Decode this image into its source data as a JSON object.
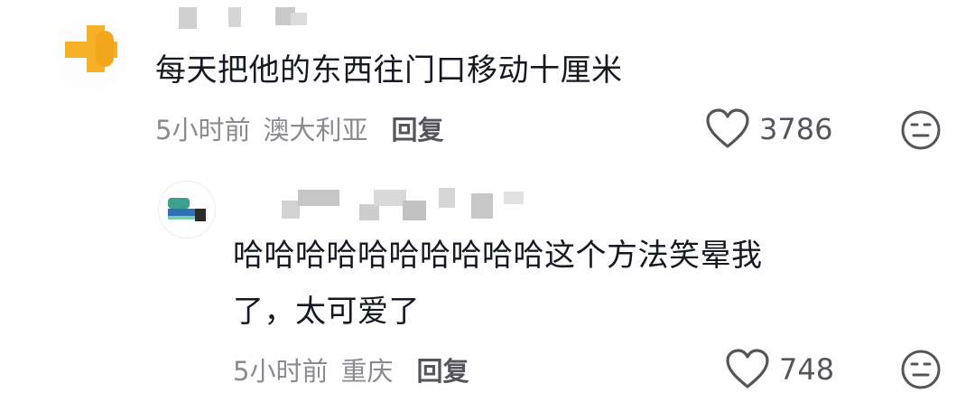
{
  "comments": [
    {
      "text": "每天把他的东西往门口移动十厘米",
      "time": "5小时前",
      "location": "澳大利亚",
      "reply_label": "回复",
      "likes": "3786"
    },
    {
      "text_line1": "哈哈哈哈哈哈哈哈哈哈这个方法笑晕我",
      "text_line2": "了，太可爱了",
      "time": "5小时前",
      "location": "重庆",
      "reply_label": "回复",
      "likes": "748"
    }
  ],
  "icons": {
    "like": "heart-outline-icon",
    "dislike": "neutral-face-icon",
    "avatar1": "yellow-cross-avatar",
    "avatar2": "green-blue-avatar"
  },
  "colors": {
    "text": "#161823",
    "meta": "#8a8b91",
    "avatar1_accent": "#f6b128",
    "avatar2_accent": "#3aa18e"
  }
}
